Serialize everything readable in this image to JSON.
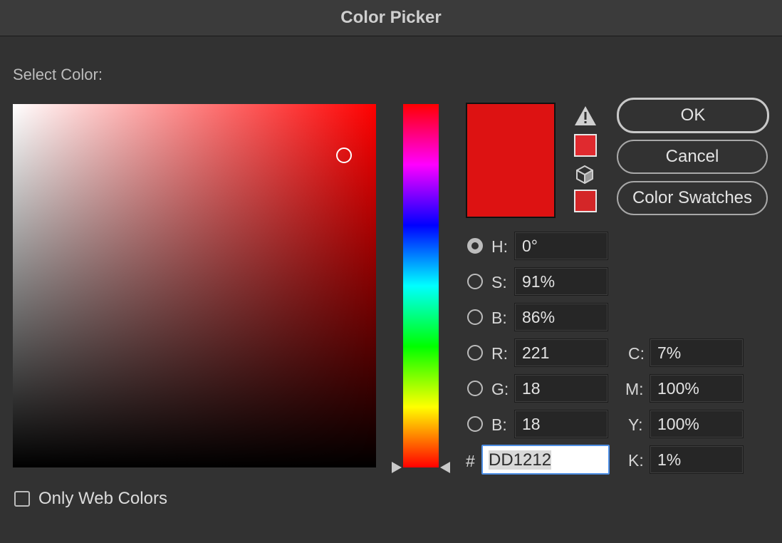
{
  "window": {
    "title": "Color Picker"
  },
  "picker": {
    "select_label": "Select Color:",
    "saturation": 0.91,
    "brightness": 0.86,
    "hue": 0
  },
  "preview": {
    "new_color": "#dd1212",
    "old_color": "#dd1212",
    "out_of_gamut_color": "#e02a2f",
    "web_safe_color": "#d42628"
  },
  "icons": {
    "warning": "warning-triangle-icon",
    "web_safe": "cube-icon"
  },
  "buttons": {
    "ok": "OK",
    "cancel": "Cancel",
    "swatches": "Color Swatches"
  },
  "fields": {
    "h": {
      "label": "H:",
      "value": "0°",
      "selected": true
    },
    "s": {
      "label": "S:",
      "value": "91%"
    },
    "b": {
      "label": "B:",
      "value": "86%"
    },
    "r": {
      "label": "R:",
      "value": "221"
    },
    "g": {
      "label": "G:",
      "value": "18"
    },
    "b2": {
      "label": "B:",
      "value": "18"
    },
    "c": {
      "label": "C:",
      "value": "7%"
    },
    "m": {
      "label": "M:",
      "value": "100%"
    },
    "y": {
      "label": "Y:",
      "value": "100%"
    },
    "k": {
      "label": "K:",
      "value": "1%"
    },
    "hex": {
      "label": "#",
      "value": "DD1212"
    }
  },
  "options": {
    "only_web_colors_label": "Only Web Colors",
    "only_web_colors_checked": false
  }
}
